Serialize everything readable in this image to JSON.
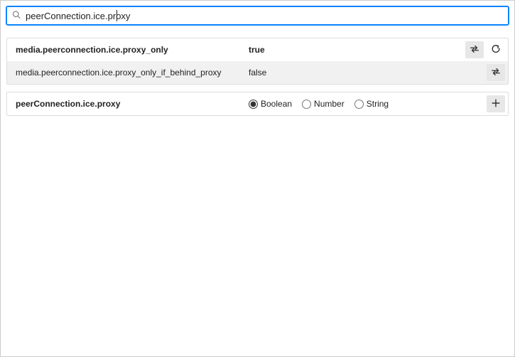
{
  "search": {
    "value": "peerConnection.ice.proxy"
  },
  "prefs": [
    {
      "name": "media.peerconnection.ice.proxy_only",
      "value": "true",
      "modified": true,
      "alt": false,
      "actions": [
        "toggle",
        "reset"
      ]
    },
    {
      "name": "media.peerconnection.ice.proxy_only_if_behind_proxy",
      "value": "false",
      "modified": false,
      "alt": true,
      "actions": [
        "toggle"
      ]
    }
  ],
  "new_pref": {
    "name": "peerConnection.ice.proxy",
    "types": [
      "Boolean",
      "Number",
      "String"
    ],
    "selected_type": "Boolean"
  }
}
